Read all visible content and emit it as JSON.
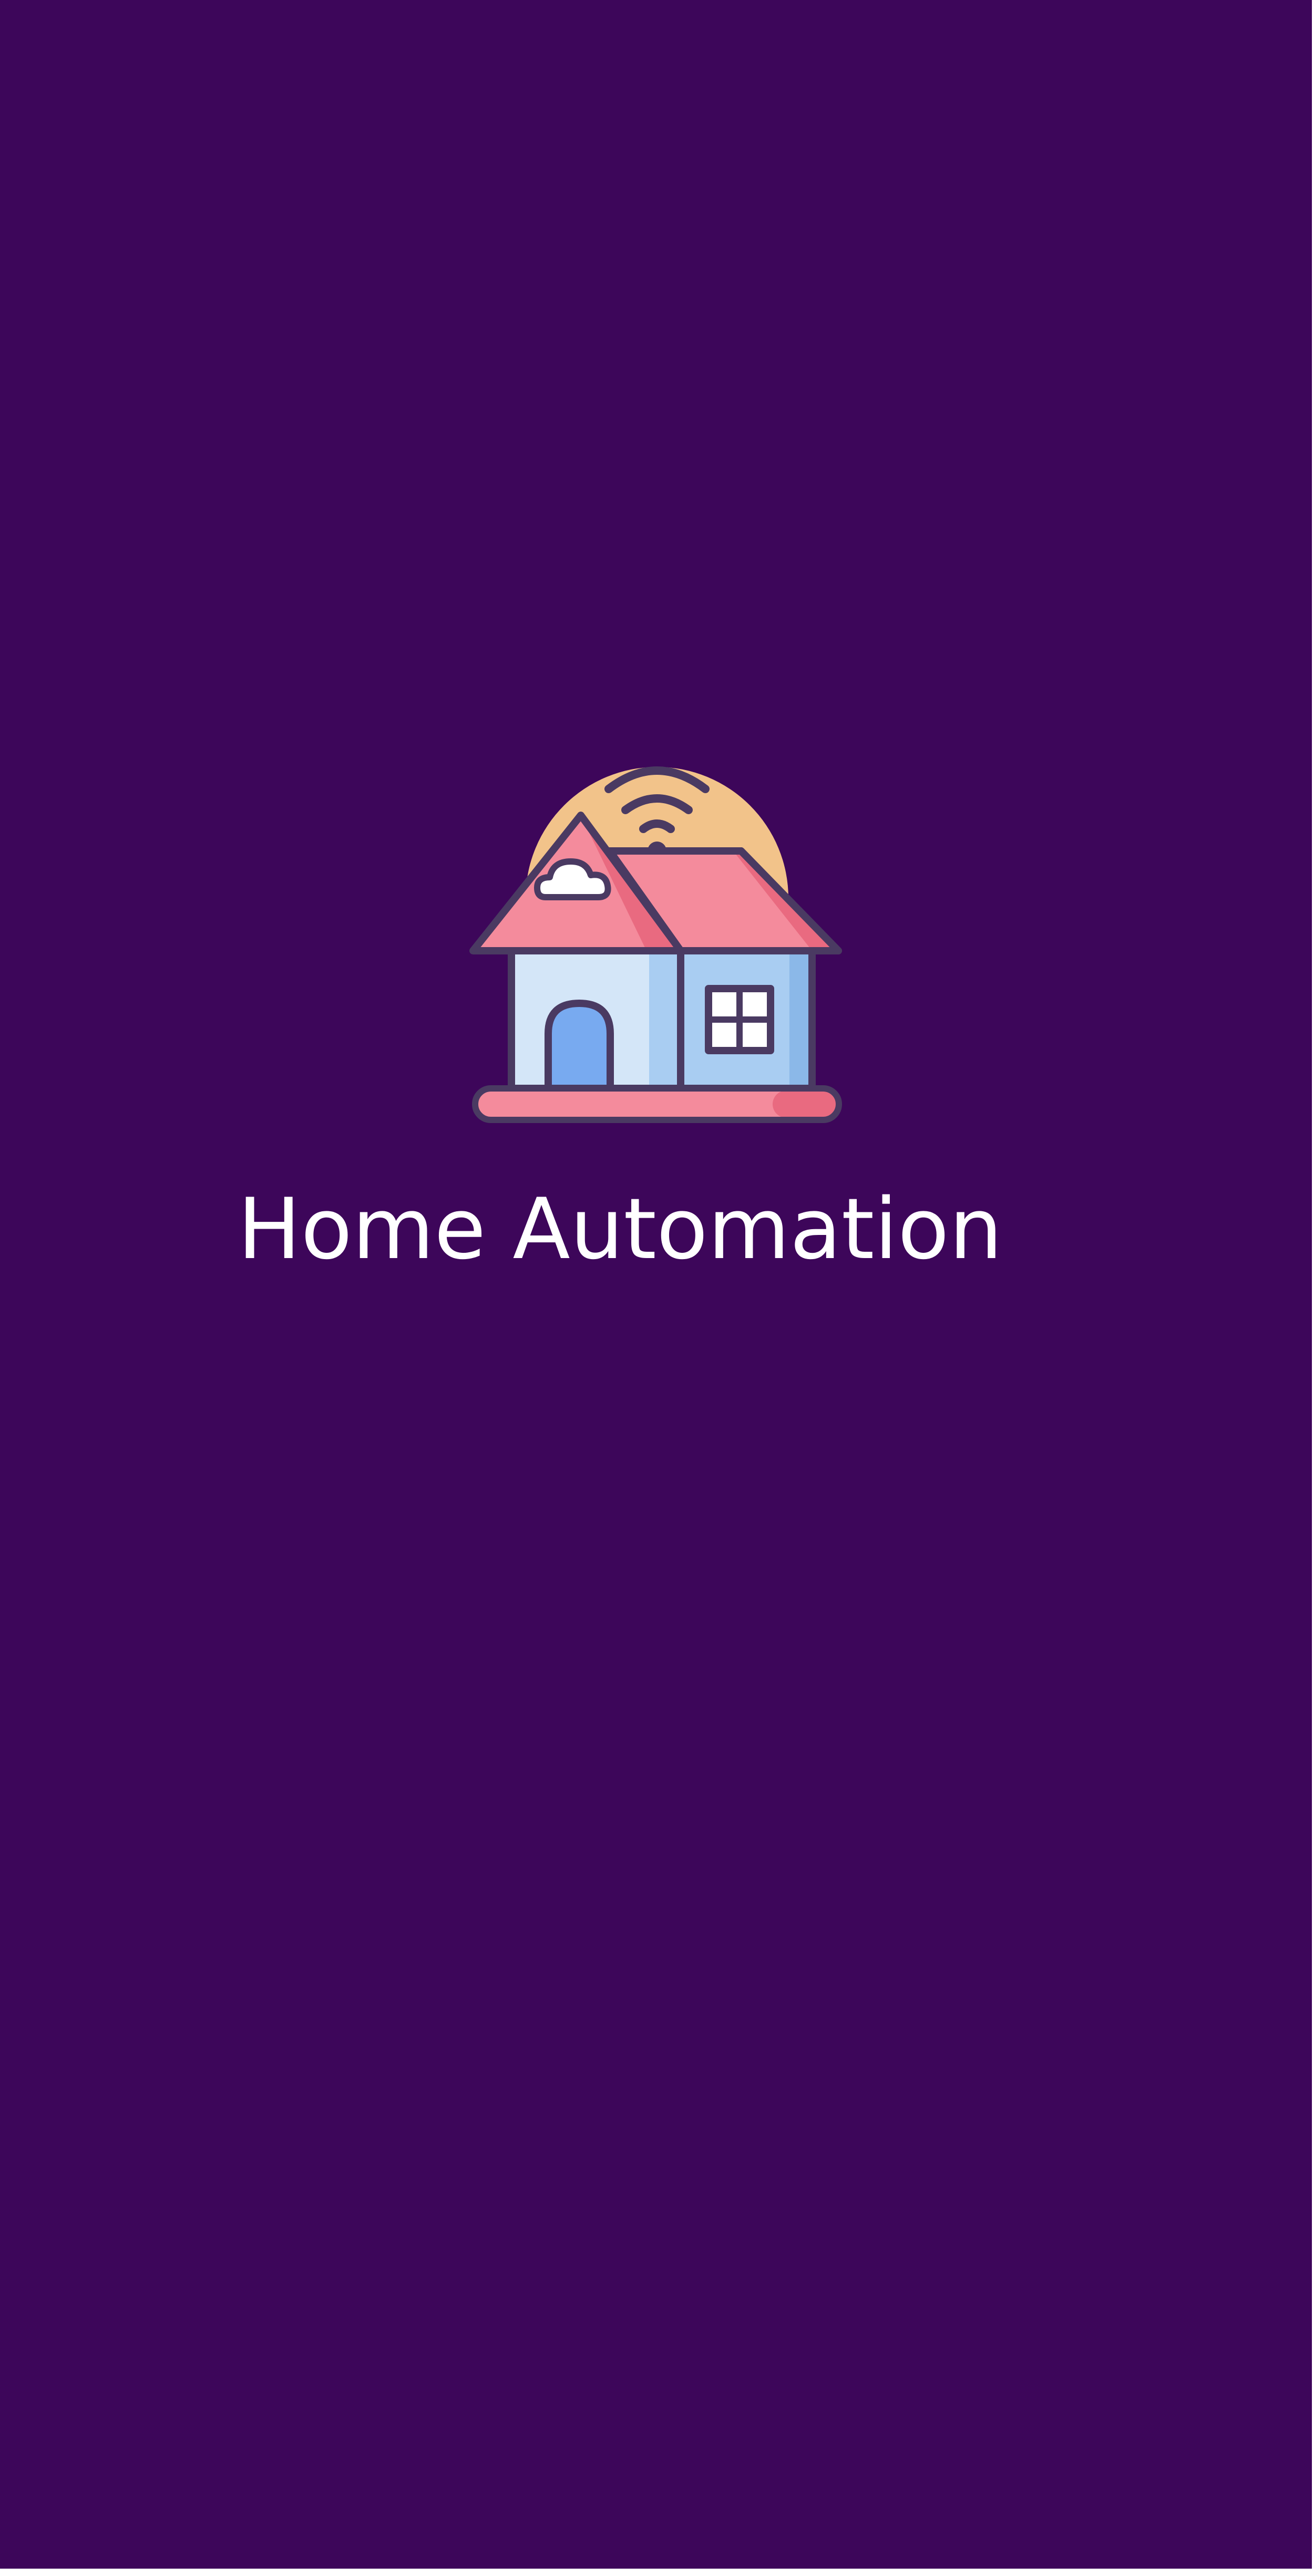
{
  "splash": {
    "app_title": "Home Automation",
    "logo_icon": "smart-home-wifi-icon",
    "background_color": "#3d065a",
    "title_color": "#ffffff"
  }
}
